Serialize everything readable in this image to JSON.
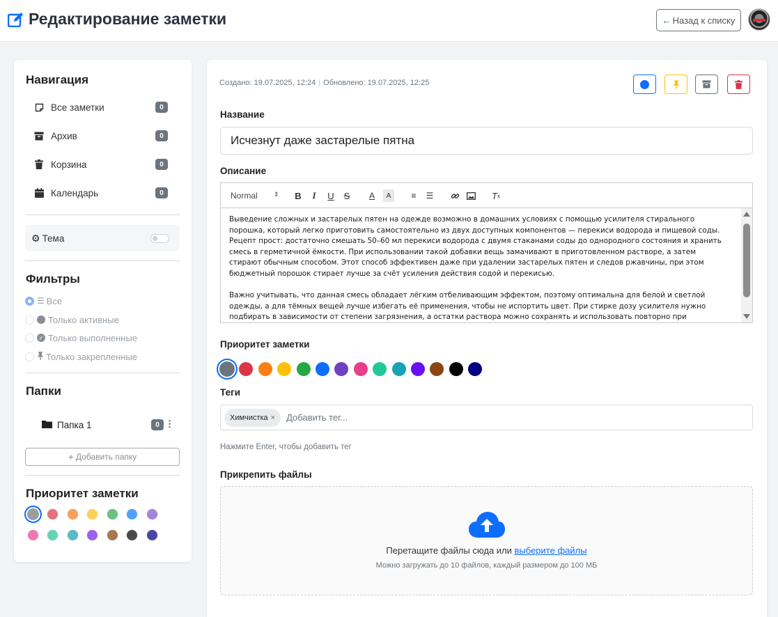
{
  "header": {
    "title": "Редактирование заметки",
    "back_label": "Назад к списку"
  },
  "sidebar": {
    "nav_title": "Навигация",
    "nav_items": [
      {
        "label": "Все заметки",
        "count": "0",
        "icon": "note-icon"
      },
      {
        "label": "Архив",
        "count": "0",
        "icon": "archive-icon"
      },
      {
        "label": "Корзина",
        "count": "0",
        "icon": "trash-icon"
      },
      {
        "label": "Календарь",
        "count": "0",
        "icon": "calendar-icon"
      }
    ],
    "theme_label": "Тема",
    "theme_on": false,
    "filters_title": "Фильтры",
    "filters": [
      {
        "label": "Все",
        "selected": true
      },
      {
        "label": "Только активные",
        "selected": false
      },
      {
        "label": "Только выполненные",
        "selected": false
      },
      {
        "label": "Только закрепленные",
        "selected": false
      }
    ],
    "folders_title": "Папки",
    "folders": [
      {
        "name": "Папка 1",
        "count": "0"
      }
    ],
    "add_folder_label": "Добавить папку",
    "priority_title": "Приоритет заметки",
    "priority_colors": [
      "#9a9da0",
      "#e4727b",
      "#f5a05d",
      "#fdd155",
      "#6cc081",
      "#4fa2f8",
      "#a584d6",
      "#ef7ab2",
      "#66d5b4",
      "#58b9c8",
      "#9b60f0",
      "#aa7650",
      "#4a4a4a",
      "#4b46a8"
    ]
  },
  "note": {
    "created": "Создано: 19.07.2025, 12:24",
    "updated": "Обновлено: 19.07.2025, 12:25",
    "title_label": "Название",
    "title_value": "Исчезнут даже застарелые пятна",
    "description_label": "Описание",
    "editor_format": "Normal",
    "description_paragraphs": [
      "Выведение сложных и застарелых пятен на одежде возможно в домашних условиях с помощью усилителя стирального порошка, который легко приготовить самостоятельно из двух доступных компонентов — перекиси водорода и пищевой соды. Рецепт прост: достаточно смешать 50–60 мл перекиси водорода с двумя стаканами соды до однородного состояния и хранить смесь в герметичной ёмкости. При использовании такой добавки вещь замачивают в приготовленном растворе, а затем стирают обычным способом. Этот способ эффективен даже при удалении застарелых пятен и следов ржавчины, при этом бюджетный порошок стирает лучше за счёт усиления действия содой и перекисью.",
      "Важно учитывать, что данная смесь обладает лёгким отбеливающим эффектом, поэтому оптимальна для белой и светлой одежды, а для тёмных вещей лучше избегать её применения, чтобы не испортить цвет. При стирке дозу усилителя нужно подбирать в зависимости от степени загрязнения, а остатки раствора можно сохранять и использовать повторно при следующих стирках. Такой домашний усилитель"
    ],
    "priority_label": "Приоритет заметки",
    "priority_colors": [
      "#6c757d",
      "#dc3545",
      "#fd7e14",
      "#ffc107",
      "#28a745",
      "#0d6efd",
      "#6f42c1",
      "#e83e8c",
      "#20c997",
      "#17a2b8",
      "#6610f2",
      "#8b4513",
      "#000000",
      "#000080"
    ],
    "tags_label": "Теги",
    "tags": [
      "Химчистка"
    ],
    "tag_placeholder": "Добавить тег...",
    "tag_hint": "Нажмите Enter, чтобы добавить тег",
    "attach_label": "Прикрепить файлы",
    "drop_text": "Перетащите файлы сюда или",
    "drop_link": "выберите файлы",
    "drop_sub": "Можно загружать до 10 файлов, каждый размером до 100 МБ"
  }
}
